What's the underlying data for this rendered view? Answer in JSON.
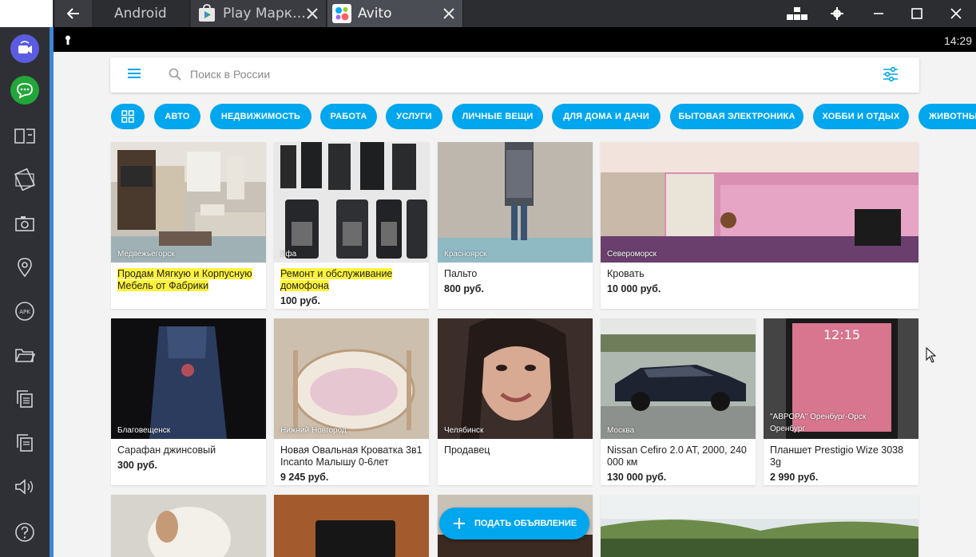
{
  "tabs": [
    {
      "label": "Android"
    },
    {
      "label": "Play Марк…"
    },
    {
      "label": "Avito"
    }
  ],
  "status": {
    "time": "14:29"
  },
  "search": {
    "placeholder": "Поиск в России"
  },
  "categories": [
    "АВТО",
    "НЕДВИЖИМОСТЬ",
    "РАБОТА",
    "УСЛУГИ",
    "ЛИЧНЫЕ ВЕЩИ",
    "ДЛЯ ДОМА И ДАЧИ",
    "БЫТОВАЯ ЭЛЕКТРОНИКА",
    "ХОББИ И ОТДЫХ",
    "ЖИВОТНЫЕ"
  ],
  "listings": [
    {
      "city": "Медвежьегорск",
      "title": "Продам Мягкую и Корпусную Мебель от Фабрики",
      "price": "",
      "highlight": true
    },
    {
      "city": "Уфа",
      "title": "Ремонт и обслуживание домофона",
      "price": "100 руб.",
      "highlight": true
    },
    {
      "city": "Красноярск",
      "title": "Пальто",
      "price": "800 руб.",
      "highlight": false
    },
    {
      "city": "Североморск",
      "title": "Кровать",
      "price": "10 000 руб.",
      "highlight": false
    },
    {
      "city": "Благовещенск",
      "title": "Сарафан джинсовый",
      "price": "300 руб.",
      "highlight": false
    },
    {
      "city": "Нижний Новгород",
      "title": "Новая Овальная Кроватка 3в1 Incanto Малышу 0-6лет",
      "price": "9 245 руб.",
      "highlight": false
    },
    {
      "city": "Челябинск",
      "title": "Продавец",
      "price": "",
      "highlight": false
    },
    {
      "city": "Москва",
      "title": "Nissan Cefiro 2.0 AT, 2000, 240 000 км",
      "price": "130 000 руб.",
      "highlight": false
    },
    {
      "city": "\"АВРОРА\" Оренбург-Орск\nОренбург",
      "title": "Планшет Prestigio Wize 3038 3g",
      "price": "2 990 руб.",
      "highlight": false
    }
  ],
  "fab": {
    "label": "ПОДАТЬ ОБЪЯВЛЕНИЕ"
  },
  "colors": {
    "accent": "#00a6ee",
    "highlight": "#fff23a",
    "sidebar": "#2e3035",
    "sidebar_edge": "#3d86d6"
  }
}
